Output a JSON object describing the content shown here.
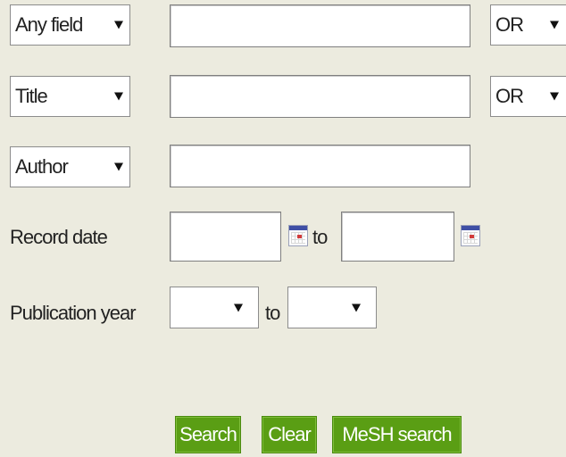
{
  "rows": [
    {
      "field_select": "Any field",
      "operator": "OR"
    },
    {
      "field_select": "Title",
      "operator": "OR"
    },
    {
      "field_select": "Author"
    }
  ],
  "record_date": {
    "label": "Record date",
    "to": "to"
  },
  "publication_year": {
    "label": "Publication year",
    "to": "to"
  },
  "buttons": {
    "search": "Search",
    "clear": "Clear",
    "mesh": "MeSH search"
  }
}
